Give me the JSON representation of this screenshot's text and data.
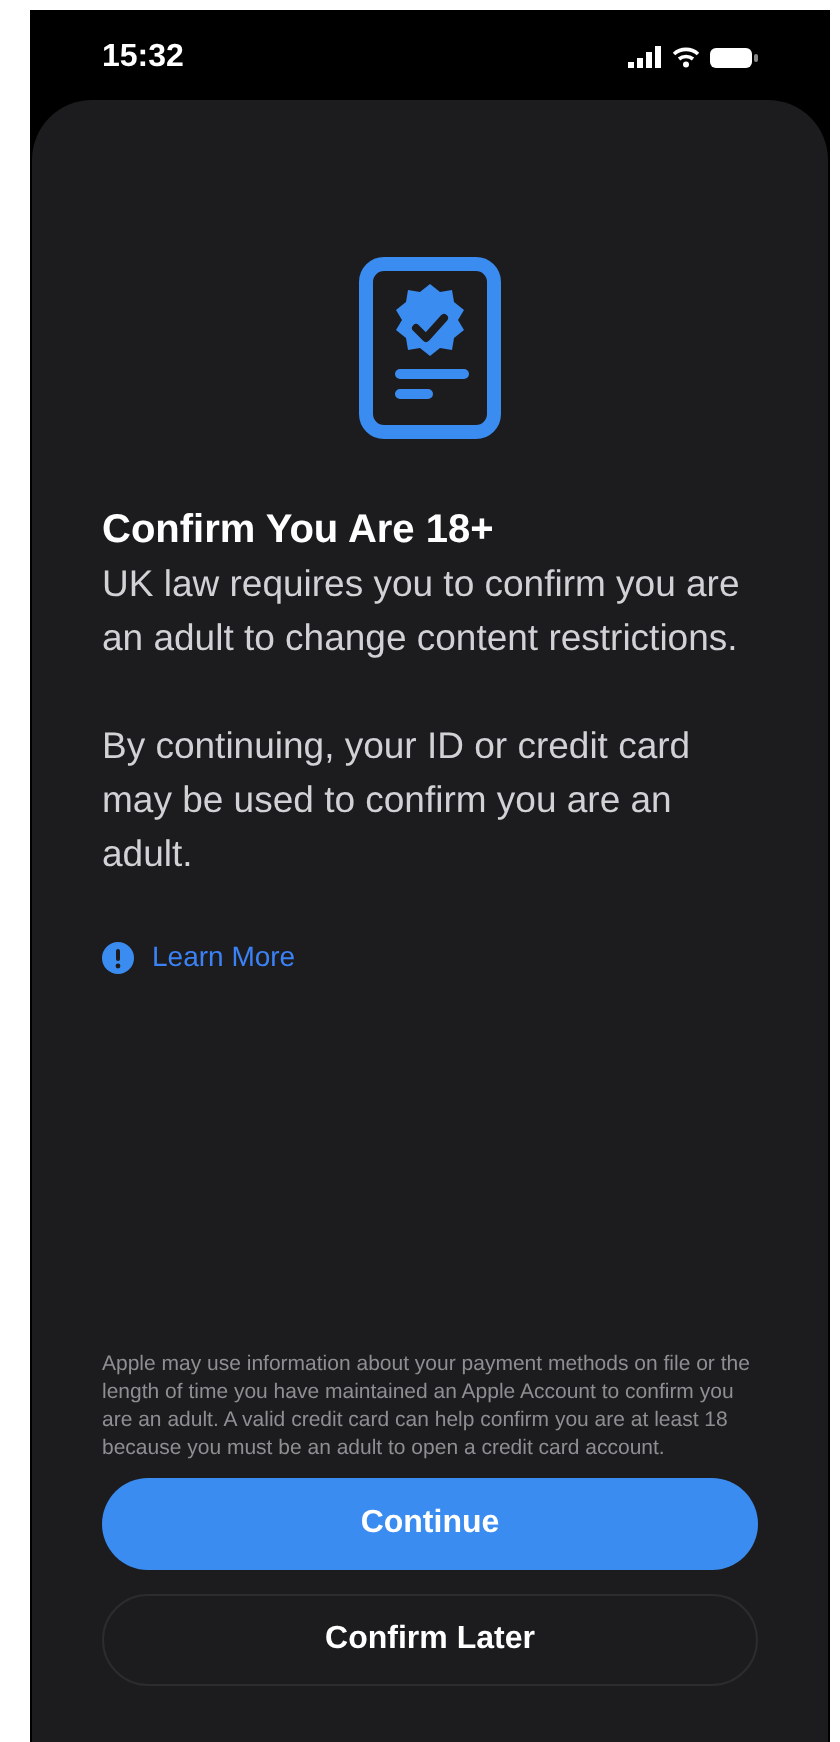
{
  "status_bar": {
    "time": "15:32"
  },
  "sheet": {
    "title": "Confirm You Are 18+",
    "paragraphs": [
      "UK law requires you to confirm you are an adult to change content restrictions.",
      "By continuing, your ID or credit card may be used to confirm you are an adult."
    ],
    "learn_more": "Learn More",
    "fine_print": "Apple may use information about your payment methods on file or the length of time you have maintained an Apple Account to confirm you are an adult. A valid credit card can help confirm you are at least 18 because you must be an adult to open a credit card account.",
    "buttons": [
      {
        "label": "Continue",
        "kind": "primary"
      },
      {
        "label": "Confirm Later",
        "kind": "secondary"
      }
    ]
  }
}
